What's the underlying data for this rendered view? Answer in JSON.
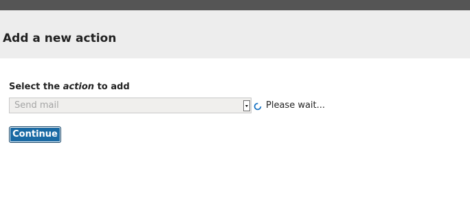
{
  "header": {
    "title": "Add a new action"
  },
  "form": {
    "label_prefix": "Select the",
    "label_emphasis": "action",
    "label_suffix": "to add",
    "select_value": "Send mail",
    "status_text": "Please wait...",
    "continue_label": "Continue"
  },
  "colors": {
    "topbar": "#555555",
    "header_background": "#ededed",
    "button_background": "#1a6aa4",
    "spinner": "#1a74c4"
  },
  "icons": {
    "spinner": "loading-spinner-icon",
    "dropdown": "dropdown-arrow-icon"
  }
}
